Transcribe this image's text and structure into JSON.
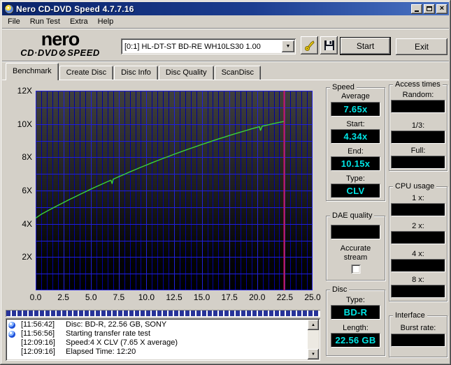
{
  "window": {
    "title": "Nero CD-DVD Speed 4.7.7.16"
  },
  "menu": {
    "items": [
      {
        "label": "File"
      },
      {
        "label": "Run Test"
      },
      {
        "label": "Extra"
      },
      {
        "label": "Help"
      }
    ]
  },
  "toolbar": {
    "logo": {
      "line1": "nero",
      "line2_left": "CD·DVD",
      "line2_right": "SPEED"
    },
    "drive_select_value": "[0:1]   HL-DT-ST BD-RE  WH10LS30 1.00",
    "start_label": "Start",
    "exit_label": "Exit"
  },
  "tabs": [
    {
      "label": "Benchmark"
    },
    {
      "label": "Create Disc"
    },
    {
      "label": "Disc Info"
    },
    {
      "label": "Disc Quality"
    },
    {
      "label": "ScanDisc"
    }
  ],
  "chart_data": {
    "type": "line",
    "title": "",
    "xlabel": "",
    "ylabel": "",
    "xlim": [
      0,
      25
    ],
    "ylim": [
      0,
      12
    ],
    "grid": {
      "minor_color": "#0000a0",
      "major_color": "#2020dd",
      "bg_top": "#404040",
      "bg_bottom": "#000000"
    },
    "x_ticks": [
      {
        "v": 0,
        "label": "0.0"
      },
      {
        "v": 2.5,
        "label": "2.5"
      },
      {
        "v": 5,
        "label": "5.0"
      },
      {
        "v": 7.5,
        "label": "7.5"
      },
      {
        "v": 10,
        "label": "10.0"
      },
      {
        "v": 12.5,
        "label": "12.5"
      },
      {
        "v": 15,
        "label": "15.0"
      },
      {
        "v": 17.5,
        "label": "17.5"
      },
      {
        "v": 20,
        "label": "20.0"
      },
      {
        "v": 22.5,
        "label": "22.5"
      },
      {
        "v": 25,
        "label": "25.0"
      }
    ],
    "y_ticks": [
      {
        "v": 12,
        "label": "12X"
      },
      {
        "v": 10,
        "label": "10X"
      },
      {
        "v": 8,
        "label": "8X"
      },
      {
        "v": 6,
        "label": "6X"
      },
      {
        "v": 4,
        "label": "4X"
      },
      {
        "v": 2,
        "label": "2X"
      }
    ],
    "series": [
      {
        "name": "read-transfer-rate",
        "color": "#3ad43a",
        "points": [
          [
            0,
            4.34
          ],
          [
            0.5,
            4.57
          ],
          [
            1,
            4.75
          ],
          [
            1.5,
            4.93
          ],
          [
            2,
            5.1
          ],
          [
            2.5,
            5.27
          ],
          [
            3,
            5.44
          ],
          [
            3.5,
            5.6
          ],
          [
            4,
            5.77
          ],
          [
            4.5,
            5.93
          ],
          [
            5,
            6.09
          ],
          [
            5.5,
            6.24
          ],
          [
            6,
            6.39
          ],
          [
            6.5,
            6.54
          ],
          [
            6.8,
            6.62
          ],
          [
            6.9,
            6.42
          ],
          [
            7,
            6.68
          ],
          [
            7.5,
            6.83
          ],
          [
            8,
            6.97
          ],
          [
            8.5,
            7.12
          ],
          [
            9,
            7.26
          ],
          [
            9.5,
            7.4
          ],
          [
            10,
            7.53
          ],
          [
            10.5,
            7.67
          ],
          [
            11,
            7.8
          ],
          [
            11.5,
            7.93
          ],
          [
            12,
            8.05
          ],
          [
            12.5,
            8.18
          ],
          [
            13,
            8.3
          ],
          [
            13.5,
            8.42
          ],
          [
            14,
            8.54
          ],
          [
            14.5,
            8.65
          ],
          [
            15,
            8.77
          ],
          [
            15.5,
            8.88
          ],
          [
            16,
            8.99
          ],
          [
            16.5,
            9.1
          ],
          [
            17,
            9.2
          ],
          [
            17.5,
            9.31
          ],
          [
            18,
            9.41
          ],
          [
            18.5,
            9.51
          ],
          [
            19,
            9.61
          ],
          [
            19.5,
            9.71
          ],
          [
            20,
            9.8
          ],
          [
            20.2,
            9.84
          ],
          [
            20.3,
            9.62
          ],
          [
            20.45,
            9.87
          ],
          [
            21,
            9.95
          ],
          [
            21.5,
            10.03
          ],
          [
            22,
            10.1
          ],
          [
            22.4,
            10.15
          ]
        ]
      }
    ],
    "end_line": {
      "x": 22.4,
      "color": "#d01858"
    }
  },
  "panels": {
    "speed": {
      "title": "Speed",
      "fields": [
        {
          "label": "Average",
          "value": "7.65x"
        },
        {
          "label": "Start:",
          "value": "4.34x"
        },
        {
          "label": "End:",
          "value": "10.15x"
        },
        {
          "label": "Type:",
          "value": "CLV"
        }
      ]
    },
    "dae_quality": {
      "title": "DAE quality",
      "display_value": "",
      "checkbox_label_1": "Accurate",
      "checkbox_label_2": "stream",
      "checked": false
    },
    "disc": {
      "title": "Disc",
      "fields": [
        {
          "label": "Type:",
          "value": "BD-R"
        },
        {
          "label": "Length:",
          "value": "22.56 GB"
        }
      ]
    },
    "access_times": {
      "title": "Access times",
      "fields": [
        {
          "label": "Random:",
          "value": ""
        },
        {
          "label": "1/3:",
          "value": ""
        },
        {
          "label": "Full:",
          "value": ""
        }
      ]
    },
    "cpu_usage": {
      "title": "CPU usage",
      "fields": [
        {
          "label": "1 x:",
          "value": ""
        },
        {
          "label": "2 x:",
          "value": ""
        },
        {
          "label": "4 x:",
          "value": ""
        },
        {
          "label": "8 x:",
          "value": ""
        }
      ]
    },
    "interface": {
      "title": "Interface",
      "fields": [
        {
          "label": "Burst rate:",
          "value": ""
        }
      ]
    }
  },
  "progress": {
    "percent": 100
  },
  "log": {
    "entries": [
      {
        "has_icon": true,
        "time": "[11:56:42]",
        "text": "Disc: BD-R, 22.56 GB, SONY"
      },
      {
        "has_icon": true,
        "time": "[11:56:56]",
        "text": "Starting transfer rate test"
      },
      {
        "has_icon": false,
        "time": "[12:09:16]",
        "text": "Speed:4 X CLV (7.65 X average)"
      },
      {
        "has_icon": false,
        "time": "[12:09:16]",
        "text": "Elapsed Time: 12:20"
      }
    ]
  },
  "icons": {
    "dropdown_arrow": "▼",
    "scroll_up": "▲",
    "scroll_down": "▼",
    "close": "×",
    "logo_disc": "⊘"
  }
}
